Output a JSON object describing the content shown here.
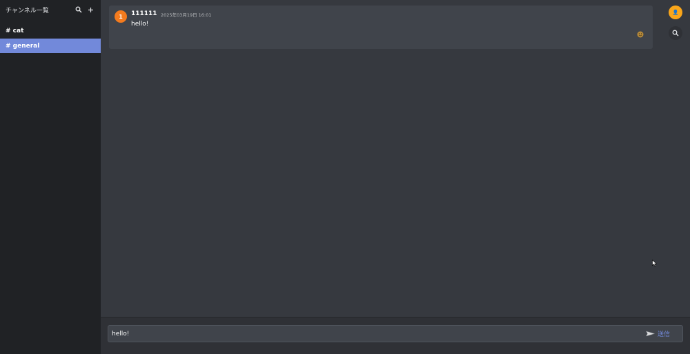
{
  "sidebar": {
    "title": "チャンネル一覧",
    "channels": [
      {
        "label": "# cat",
        "active": false
      },
      {
        "label": "# general",
        "active": true
      }
    ]
  },
  "messages": [
    {
      "avatar_initial": "1",
      "author": "111111",
      "timestamp": "2025年03月19日 16:01",
      "text": "hello!",
      "reaction_icon": "emoji-face-icon"
    }
  ],
  "header": {
    "user_avatar_label": "👤"
  },
  "composer": {
    "value": "hello!",
    "send_label": "送信",
    "send_icon": "paper-plane-icon"
  },
  "colors": {
    "accent": "#7289da",
    "sidebar_bg": "#202225",
    "main_bg": "#36393f",
    "message_bg": "#40444b",
    "avatar": "#f47b1e",
    "user_circle": "#faa61a"
  }
}
